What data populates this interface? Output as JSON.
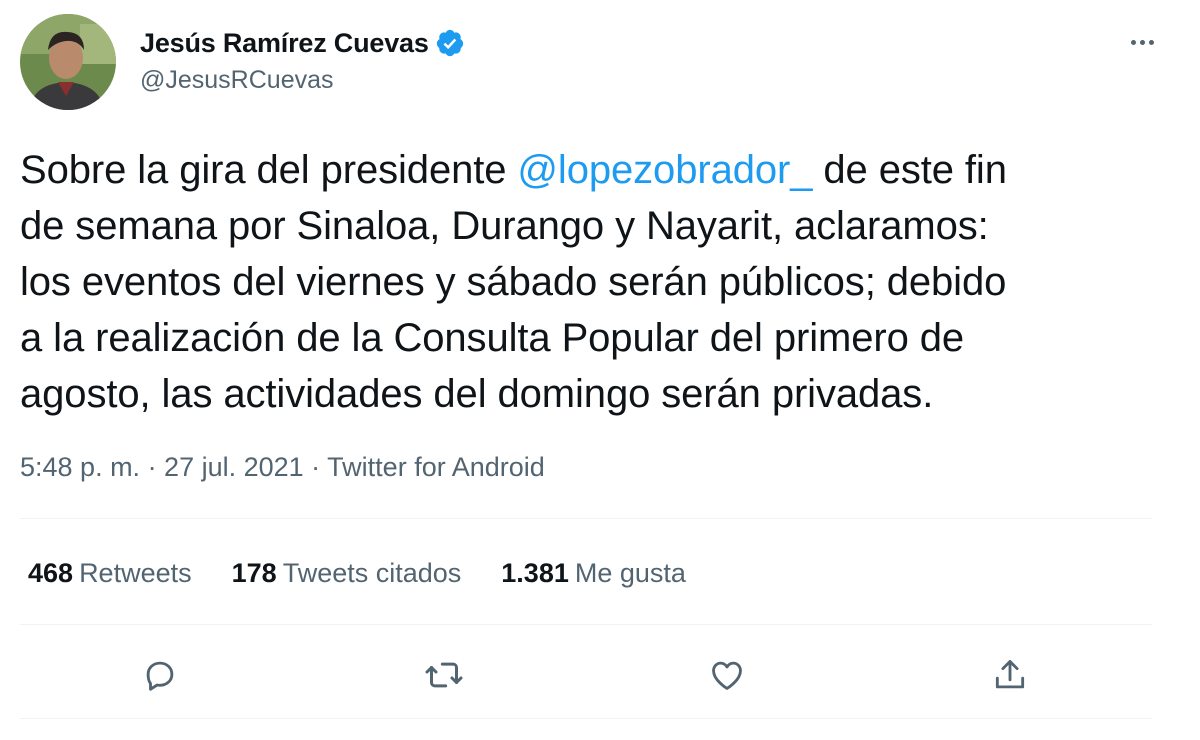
{
  "author": {
    "display_name": "Jesús Ramírez Cuevas",
    "handle": "@JesusRCuevas",
    "verified_icon": "verified-badge-icon",
    "avatar_icon": "profile-avatar"
  },
  "tweet": {
    "lines": [
      {
        "pre": "Sobre la gira del presidente ",
        "mention": "@lopezobrador_",
        "post": " de este fin"
      },
      {
        "pre": "de semana por Sinaloa, Durango y Nayarit, aclaramos:"
      },
      {
        "pre": "los eventos del viernes y sábado serán públicos; debido"
      },
      {
        "pre": "a la realización de la Consulta Popular del primero de"
      },
      {
        "pre": "agosto, las actividades del domingo serán privadas."
      }
    ]
  },
  "meta": "5:48 p. m. · 27 jul. 2021 · Twitter for Android",
  "stats": {
    "retweets_count": "468",
    "retweets_label": "Retweets",
    "quotes_count": "178",
    "quotes_label": "Tweets citados",
    "likes_count": "1.381",
    "likes_label": "Me gusta"
  },
  "actions": [
    "reply-icon",
    "retweet-icon",
    "like-icon",
    "share-icon"
  ],
  "colors": {
    "accent": "#1d9bf0",
    "text": "#0f1419",
    "muted": "#536471",
    "divider": "#eff3f4"
  }
}
